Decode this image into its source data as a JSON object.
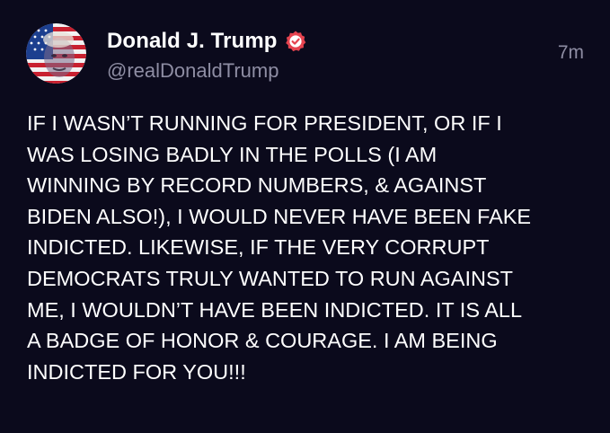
{
  "post": {
    "author": {
      "display_name": "Donald J. Trump",
      "handle": "@realDonaldTrump",
      "avatar_icon": "flag-portrait-avatar",
      "verified_icon": "verified-badge-icon",
      "verified_color": "#e5434f"
    },
    "timestamp": "7m",
    "body_lines": [
      "IF I WASN’T RUNNING FOR PRESIDENT, OR IF I",
      "WAS LOSING BADLY IN THE POLLS (I AM",
      "WINNING BY RECORD NUMBERS, & AGAINST",
      "BIDEN ALSO!), I WOULD NEVER HAVE BEEN FAKE",
      "INDICTED. LIKEWISE, IF THE VERY CORRUPT",
      "DEMOCRATS TRULY WANTED TO RUN AGAINST",
      "ME, I WOULDN’T HAVE BEEN INDICTED. IT IS ALL",
      "A BADGE OF HONOR & COURAGE. I AM BEING",
      "INDICTED FOR YOU!!!"
    ]
  },
  "colors": {
    "background": "#0b0a1c",
    "text": "#ffffff",
    "secondary_text": "#8e8da3",
    "accent": "#e5434f"
  }
}
